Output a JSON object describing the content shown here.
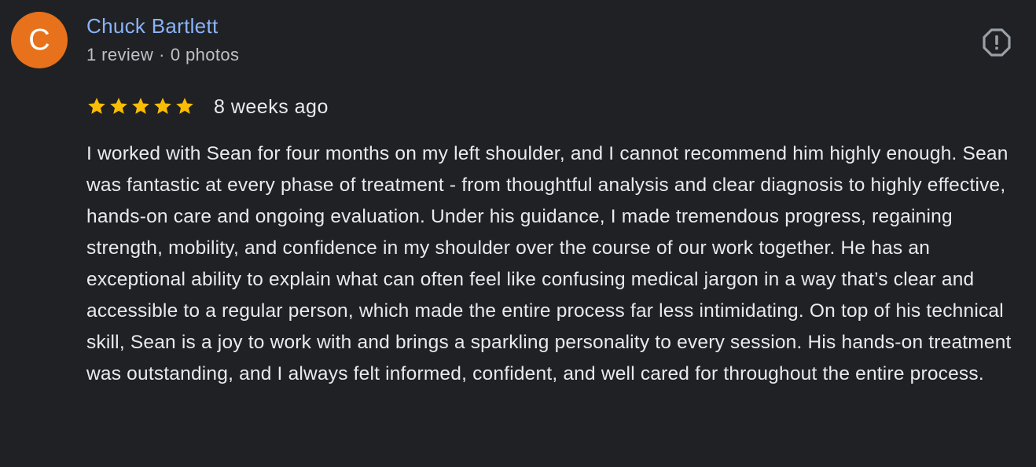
{
  "reviewer": {
    "avatar_letter": "C",
    "avatar_color": "#e8711c",
    "name": "Chuck Bartlett",
    "reviews_count": "1 review",
    "separator": "·",
    "photos_count": "0 photos"
  },
  "report_icon": "report-flag-icon",
  "rating": {
    "stars": 5,
    "max_stars": 5,
    "star_color": "#fbbc04",
    "age": "8 weeks ago"
  },
  "review": {
    "text": "I worked with Sean for four months on my left shoulder, and I cannot recommend him highly enough. Sean was fantastic at every phase of treatment - from thoughtful analysis and clear diagnosis to highly effective, hands-on care and ongoing evaluation. Under his guidance, I made tremendous progress, regaining strength, mobility, and confidence in my shoulder over the course of our work together. He has an exceptional ability to explain what can often feel like confusing medical jargon in a way that’s clear and accessible to a regular person, which made the entire process far less intimidating. On top of his technical skill, Sean is a joy to work with and brings a sparkling personality to every session. His hands-on treatment was outstanding, and I always felt informed, confident, and well cared for throughout the entire process."
  }
}
